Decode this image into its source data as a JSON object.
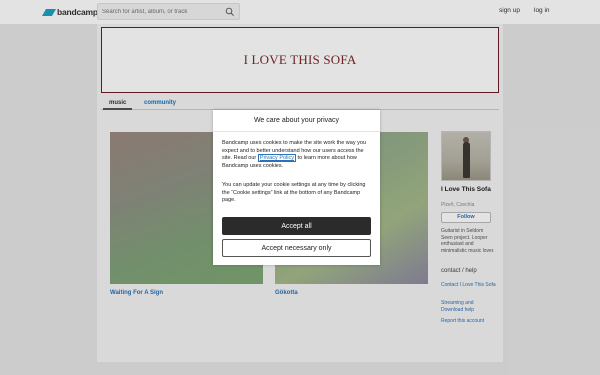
{
  "header": {
    "logo_text": "bandcamp",
    "search_placeholder": "Search for artist, album, or track",
    "signup_label": "sign up",
    "login_label": "log in"
  },
  "banner": {
    "title": "I LOVE THIS SOFA"
  },
  "tabs": [
    {
      "label": "music",
      "active": true
    },
    {
      "label": "community",
      "active": false
    }
  ],
  "albums": [
    {
      "title": "Waiting For A Sign"
    },
    {
      "title": "Gökotta"
    }
  ],
  "sidebar": {
    "artist_name": "I Love This Sofa",
    "location": "Plzeň, Czechia",
    "follow_label": "Follow",
    "bio": "Guitarist in Seldom Seen project. Looper enthusiast and minimalistic music lover.",
    "contact_heading": "contact / help",
    "links": [
      "Contact I Love This Sofa",
      "Streaming and Download help",
      "Report this account"
    ]
  },
  "cookie_dialog": {
    "title": "We care about your privacy",
    "text_before_link": "Bandcamp uses cookies to make the site work the way you expect and to better understand how our users access the site. Read our ",
    "link_label": "Privacy Policy",
    "text_after_link": " to learn more about how Bandcamp uses cookies.",
    "paragraph2": "You can update your cookie settings at any time by clicking the “Cookie settings” link at the bottom of any Bandcamp page.",
    "accept_all_label": "Accept all",
    "accept_necessary_label": "Accept necessary only"
  },
  "colors": {
    "brand": "#1da0c3",
    "link": "#2b72b8",
    "banner_border": "#6b1e25",
    "primary_button": "#2b2b2b"
  }
}
